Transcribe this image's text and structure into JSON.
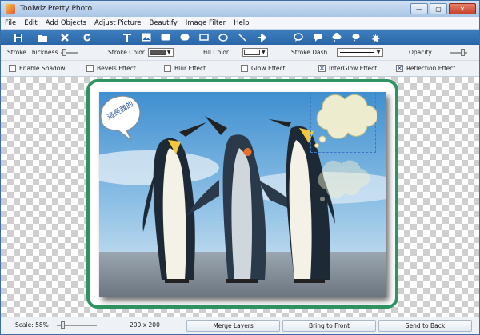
{
  "window": {
    "title": "Toolwiz Pretty Photo",
    "min_glyph": "—",
    "max_glyph": "▢",
    "close_glyph": "✕"
  },
  "menu": [
    "File",
    "Edit",
    "Add Objects",
    "Adjust Picture",
    "Beautify",
    "Image Filter",
    "Help"
  ],
  "toolbar_icons": [
    "save-icon",
    "open-folder-icon",
    "delete-icon",
    "rotate-icon",
    "text-icon",
    "image-icon",
    "rounded-rect-icon",
    "rounded-rect-filled-icon",
    "rectangle-icon",
    "ellipse-icon",
    "line-icon",
    "arrow-icon",
    "oval-balloon-icon",
    "rect-balloon-icon",
    "cloud-balloon-icon",
    "thought-balloon-icon",
    "splat-icon"
  ],
  "props": {
    "stroke_thickness": "Stroke Thickness",
    "stroke_color": "Stroke Color",
    "fill_color": "Fill Color",
    "stroke_dash": "Stroke Dash",
    "opacity": "Opacity",
    "stroke_color_value": "#555555",
    "fill_color_value": "#ffffff"
  },
  "effects": [
    {
      "label": "Enable Shadow",
      "checked": false
    },
    {
      "label": "Bevels Effect",
      "checked": false
    },
    {
      "label": "Blur Effect",
      "checked": false
    },
    {
      "label": "Glow Effect",
      "checked": false
    },
    {
      "label": "InterGlow Effect",
      "checked": true
    },
    {
      "label": "Reflection Effect",
      "checked": true
    }
  ],
  "canvas": {
    "balloon_text": "這是我的",
    "frame_color": "#2f9462"
  },
  "status": {
    "scale": "Scale: 58%",
    "size": "200 x 200",
    "merge": "Merge Layers",
    "front": "Bring to Front",
    "back": "Send to Back"
  }
}
